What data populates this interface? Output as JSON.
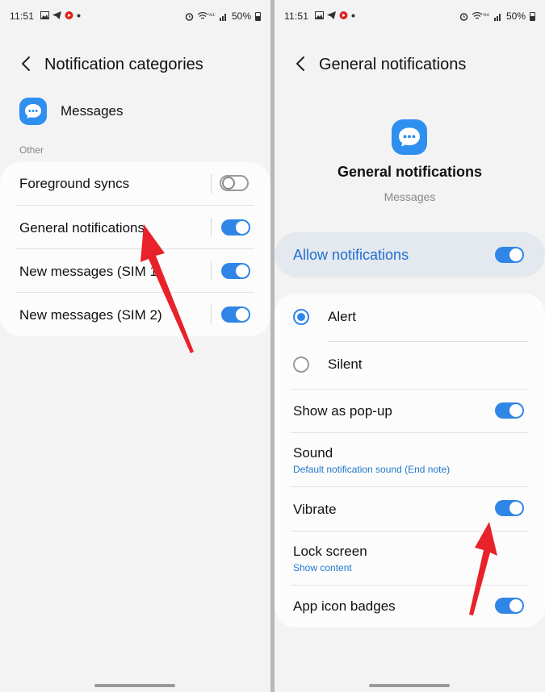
{
  "left": {
    "status": {
      "time": "11:51",
      "battery": "50%"
    },
    "header": {
      "title": "Notification categories"
    },
    "app": {
      "name": "Messages",
      "icon": "messages-icon"
    },
    "section": "Other",
    "items": [
      {
        "label": "Foreground syncs",
        "toggle": "off"
      },
      {
        "label": "General notifications",
        "toggle": "on"
      },
      {
        "label": "New messages (SIM 1)",
        "toggle": "on"
      },
      {
        "label": "New messages (SIM 2)",
        "toggle": "on"
      }
    ]
  },
  "right": {
    "status": {
      "time": "11:51",
      "battery": "50%"
    },
    "header": {
      "title": "General notifications"
    },
    "app": {
      "title": "General notifications",
      "subtitle": "Messages",
      "icon": "messages-icon"
    },
    "allow": {
      "label": "Allow notifications",
      "toggle": "on"
    },
    "options": [
      {
        "label": "Alert",
        "selected": true
      },
      {
        "label": "Silent",
        "selected": false
      }
    ],
    "settings": {
      "popup": {
        "label": "Show as pop-up",
        "toggle": "on"
      },
      "sound": {
        "label": "Sound",
        "value": "Default notification sound (End note)"
      },
      "vibrate": {
        "label": "Vibrate",
        "toggle": "on"
      },
      "lock": {
        "label": "Lock screen",
        "value": "Show content"
      },
      "badges": {
        "label": "App icon badges",
        "toggle": "on"
      }
    }
  },
  "colors": {
    "accent": "#2f86e6",
    "arrow": "#e8222a",
    "app_icon": "#2f8ff0"
  }
}
